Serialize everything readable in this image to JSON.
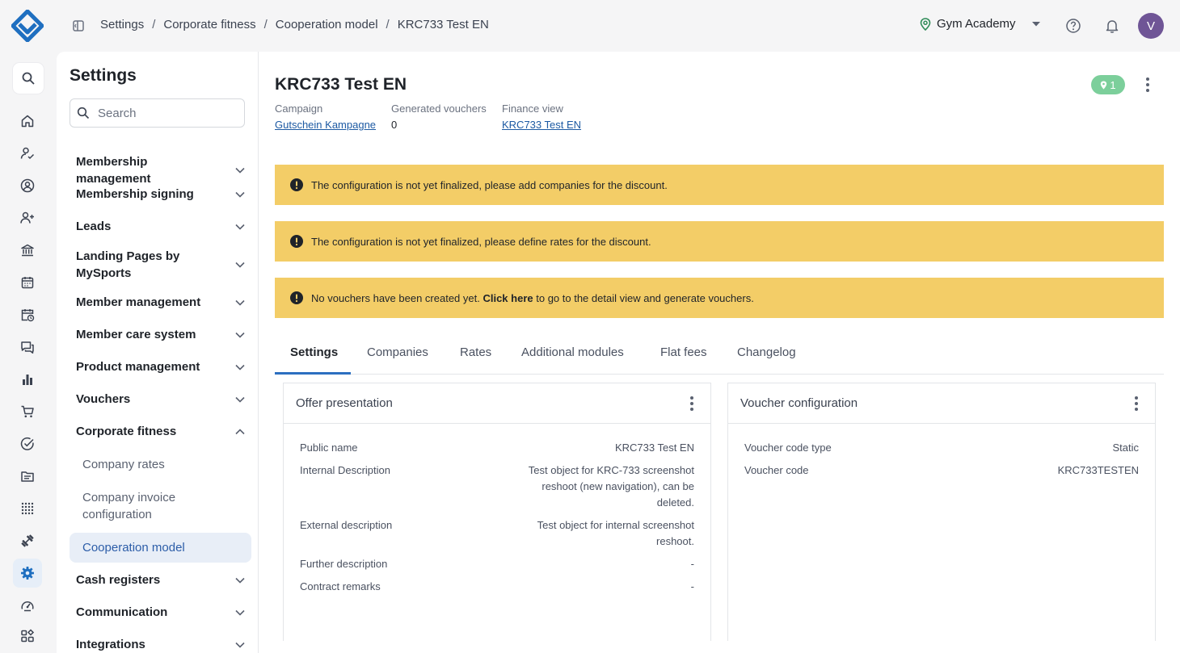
{
  "breadcrumb": [
    "Settings",
    "Corporate fitness",
    "Cooperation model",
    "KRC733 Test EN"
  ],
  "studio": {
    "name": "Gym Academy"
  },
  "user": {
    "initial": "V"
  },
  "rail": {
    "icons": [
      "search-icon",
      "home-icon",
      "user-check-icon",
      "user-circle-icon",
      "user-plus-icon",
      "bank-icon",
      "calendar-icon",
      "calendar-clock-icon",
      "chat-icon",
      "bar-chart-icon",
      "cart-icon",
      "check-circle-icon",
      "folder-icon",
      "dots-grid-icon",
      "dumbbell-icon",
      "gear-icon",
      "gauge-icon",
      "widgets-icon"
    ],
    "active": "gear-icon"
  },
  "sidebar": {
    "title": "Settings",
    "search_placeholder": "Search",
    "items": [
      {
        "label": "Membership management",
        "expanded": false
      },
      {
        "label": "Membership signing",
        "expanded": false
      },
      {
        "label": "Leads",
        "expanded": false
      },
      {
        "label": "Landing Pages by MySports",
        "expanded": false
      },
      {
        "label": "Member management",
        "expanded": false
      },
      {
        "label": "Member care system",
        "expanded": false
      },
      {
        "label": "Product management",
        "expanded": false
      },
      {
        "label": "Vouchers",
        "expanded": false
      },
      {
        "label": "Corporate fitness",
        "expanded": true,
        "children": [
          "Company rates",
          "Company invoice configuration",
          "Cooperation model"
        ],
        "active_child": "Cooperation model"
      },
      {
        "label": "Cash registers",
        "expanded": false
      },
      {
        "label": "Communication",
        "expanded": false
      },
      {
        "label": "Integrations",
        "expanded": false
      }
    ]
  },
  "page": {
    "title": "KRC733 Test EN",
    "location_badge": "1",
    "meta": [
      {
        "label": "Campaign",
        "value": "Gutschein Kampagne",
        "link": true
      },
      {
        "label": "Generated vouchers",
        "value": "0",
        "link": false
      },
      {
        "label": "Finance view",
        "value": "KRC733 Test EN",
        "link": true
      }
    ]
  },
  "alerts": [
    {
      "text": "The configuration is not yet finalized, please add companies for the discount."
    },
    {
      "text": "The configuration is not yet finalized, please define rates for the discount."
    },
    {
      "prefix": "No vouchers have been created yet. ",
      "bold": "Click here",
      "suffix": " to go to the detail view and generate vouchers."
    }
  ],
  "tabs": [
    "Settings",
    "Companies",
    "Rates",
    "Additional modules",
    "Flat fees",
    "Changelog"
  ],
  "active_tab": "Settings",
  "cards": {
    "offer": {
      "title": "Offer presentation",
      "rows": [
        {
          "k": "Public name",
          "v": "KRC733 Test EN"
        },
        {
          "k": "Internal Description",
          "v": "Test object for KRC-733 screenshot reshoot (new navigation), can be deleted."
        },
        {
          "k": "External description",
          "v": "Test object for internal screenshot reshoot."
        },
        {
          "k": "Further description",
          "v": "-"
        },
        {
          "k": "Contract remarks",
          "v": "-"
        }
      ]
    },
    "voucher": {
      "title": "Voucher configuration",
      "rows": [
        {
          "k": "Voucher code type",
          "v": "Static"
        },
        {
          "k": "Voucher code",
          "v": "KRC733TESTEN"
        }
      ]
    }
  },
  "colors": {
    "accent": "#2c6fc0",
    "warning": "#f3cd67",
    "badge": "#7ccf9b",
    "avatar": "#6f5596"
  }
}
